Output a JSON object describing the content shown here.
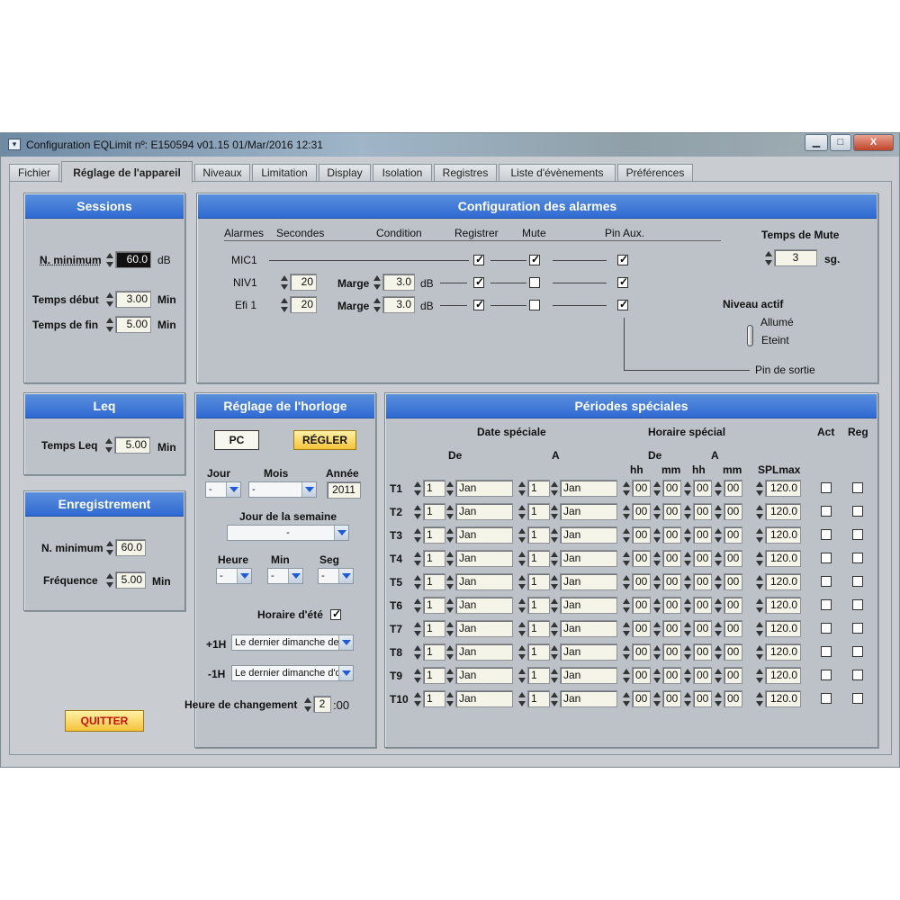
{
  "window": {
    "title": "Configuration EQLimit nº: E150594   v01.15   01/Mar/2016   12:31",
    "min": "▁",
    "max": "□",
    "close": "X"
  },
  "tabs": [
    "Fichier",
    "Réglage de l'appareil",
    "Niveaux",
    "Limitation",
    "Display",
    "Isolation",
    "Registres",
    "Liste d'évènements",
    "Préférences"
  ],
  "sessions": {
    "title": "Sessions",
    "nmin_label": "N. minimum",
    "nmin_value": "60.0",
    "nmin_unit": "dB",
    "debut_label": "Temps début",
    "debut_value": "3.00",
    "debut_unit": "Min",
    "fin_label": "Temps de fin",
    "fin_value": "5.00",
    "fin_unit": "Min"
  },
  "alarmes": {
    "title": "Configuration des alarmes",
    "headers": {
      "alarmes": "Alarmes",
      "secondes": "Secondes",
      "condition": "Condition",
      "registrer": "Registrer",
      "mute": "Mute",
      "pin": "Pin Aux."
    },
    "rows": [
      {
        "name": "MIC1",
        "sec": "",
        "marge": "",
        "val": "",
        "unit": "",
        "reg": true,
        "mute": true,
        "pin": true
      },
      {
        "name": "NIV1",
        "sec": "20",
        "marge": "Marge",
        "val": "3.0",
        "unit": "dB",
        "reg": true,
        "mute": false,
        "pin": true
      },
      {
        "name": "Efi 1",
        "sec": "20",
        "marge": "Marge",
        "val": "3.0",
        "unit": "dB",
        "reg": true,
        "mute": false,
        "pin": true
      }
    ],
    "mute_time_label": "Temps de Mute",
    "mute_time_value": "3",
    "mute_time_unit": "sg.",
    "niveau_label": "Niveau actif",
    "allume": "Allumé",
    "eteint": "Eteint",
    "pin_sortie": "Pin de sortie"
  },
  "leq": {
    "title": "Leq",
    "label": "Temps Leq",
    "value": "5.00",
    "unit": "Min"
  },
  "enreg": {
    "title": "Enregistrement",
    "nmin_label": "N. minimum",
    "nmin_value": "60.0",
    "freq_label": "Fréquence",
    "freq_value": "5.00",
    "freq_unit": "Min"
  },
  "quitter": "QUITTER",
  "horloge": {
    "title": "Réglage de l'horloge",
    "pc": "PC",
    "regler": "RÉGLER",
    "jour": "Jour",
    "mois": "Mois",
    "annee": "Année",
    "jour_val": "-",
    "mois_val": "-",
    "annee_val": "2011",
    "semaine_label": "Jour de la semaine",
    "semaine_val": "-",
    "heure": "Heure",
    "min": "Min",
    "seg": "Seg",
    "heure_val": "-",
    "min_val": "-",
    "seg_val": "-",
    "ete_label": "Horaire d'été",
    "ete": true,
    "p1h": "+1H",
    "p1h_val": "Le dernier dimanche de",
    "m1h": "-1H",
    "m1h_val": "Le dernier dimanche d'o",
    "changement_label": "Heure de changement",
    "changement_val": "2",
    "changement_suffix": ":00"
  },
  "periodes": {
    "title": "Périodes spéciales",
    "date_label": "Date spéciale",
    "horaire_label": "Horaire spécial",
    "de": "De",
    "a": "A",
    "hh": "hh",
    "mm": "mm",
    "spl": "SPLmax",
    "act": "Act",
    "reg": "Reg",
    "rows": [
      {
        "t": "T1",
        "d1": "1",
        "m1": "Jan",
        "d2": "1",
        "m2": "Jan",
        "h1": "00",
        "n1": "00",
        "h2": "00",
        "n2": "00",
        "spl": "120.0"
      },
      {
        "t": "T2",
        "d1": "1",
        "m1": "Jan",
        "d2": "1",
        "m2": "Jan",
        "h1": "00",
        "n1": "00",
        "h2": "00",
        "n2": "00",
        "spl": "120.0"
      },
      {
        "t": "T3",
        "d1": "1",
        "m1": "Jan",
        "d2": "1",
        "m2": "Jan",
        "h1": "00",
        "n1": "00",
        "h2": "00",
        "n2": "00",
        "spl": "120.0"
      },
      {
        "t": "T4",
        "d1": "1",
        "m1": "Jan",
        "d2": "1",
        "m2": "Jan",
        "h1": "00",
        "n1": "00",
        "h2": "00",
        "n2": "00",
        "spl": "120.0"
      },
      {
        "t": "T5",
        "d1": "1",
        "m1": "Jan",
        "d2": "1",
        "m2": "Jan",
        "h1": "00",
        "n1": "00",
        "h2": "00",
        "n2": "00",
        "spl": "120.0"
      },
      {
        "t": "T6",
        "d1": "1",
        "m1": "Jan",
        "d2": "1",
        "m2": "Jan",
        "h1": "00",
        "n1": "00",
        "h2": "00",
        "n2": "00",
        "spl": "120.0"
      },
      {
        "t": "T7",
        "d1": "1",
        "m1": "Jan",
        "d2": "1",
        "m2": "Jan",
        "h1": "00",
        "n1": "00",
        "h2": "00",
        "n2": "00",
        "spl": "120.0"
      },
      {
        "t": "T8",
        "d1": "1",
        "m1": "Jan",
        "d2": "1",
        "m2": "Jan",
        "h1": "00",
        "n1": "00",
        "h2": "00",
        "n2": "00",
        "spl": "120.0"
      },
      {
        "t": "T9",
        "d1": "1",
        "m1": "Jan",
        "d2": "1",
        "m2": "Jan",
        "h1": "00",
        "n1": "00",
        "h2": "00",
        "n2": "00",
        "spl": "120.0"
      },
      {
        "t": "T10",
        "d1": "1",
        "m1": "Jan",
        "d2": "1",
        "m2": "Jan",
        "h1": "00",
        "n1": "00",
        "h2": "00",
        "n2": "00",
        "spl": "120.0"
      }
    ]
  }
}
